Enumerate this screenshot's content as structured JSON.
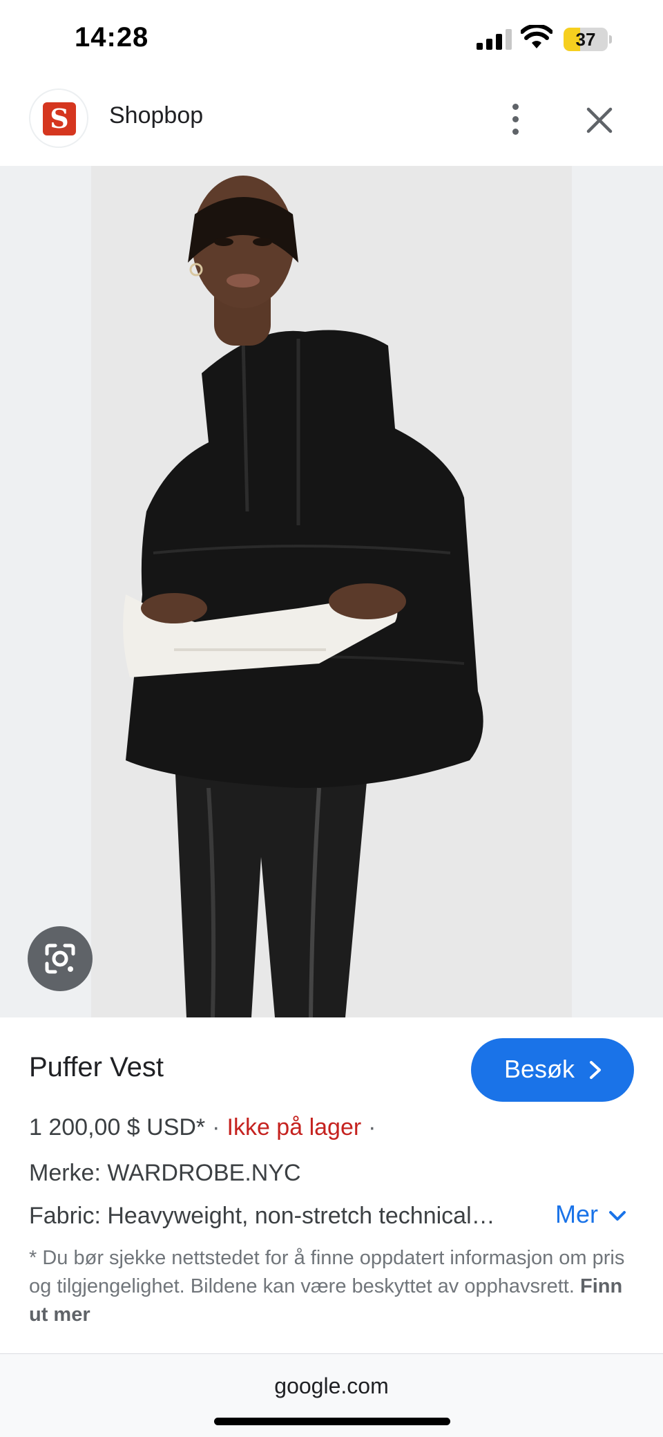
{
  "status_bar": {
    "time": "14:28",
    "battery_level": "37",
    "battery_fraction": 0.37
  },
  "header": {
    "favicon_letter": "S",
    "site_name": "Shopbop",
    "icons": [
      "more-vert-icon",
      "close-icon"
    ]
  },
  "image": {
    "description_icon": "google-lens-icon"
  },
  "product": {
    "title": "Puffer Vest",
    "visit_label": "Besøk",
    "price": "1 200,00 $ USD*",
    "stock_status": "Ikke på lager",
    "separator": "·",
    "brand": "Merke: WARDROBE.NYC",
    "fabric": "Fabric: Heavyweight, non-stretch technical…",
    "more_label": "Mer",
    "disclaimer": "* Du bør sjekke nettstedet for å finne oppdatert informasjon om pris og tilgjengelighet. Bildene kan være beskyttet av opphavsrett.",
    "learn_more": "Finn ut mer"
  },
  "url_bar": {
    "domain": "google.com"
  },
  "colors": {
    "accent": "#1a73e8",
    "stock_red": "#c5221f",
    "favicon_red": "#d5361f",
    "battery_yellow": "#f6cf1f"
  }
}
